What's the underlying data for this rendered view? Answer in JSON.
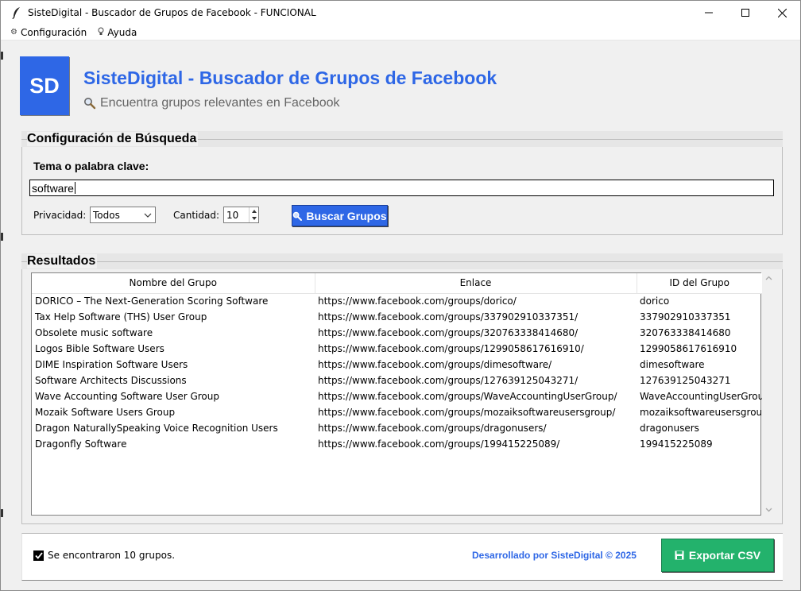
{
  "window": {
    "title": "SisteDigital - Buscador de Grupos de Facebook - FUNCIONAL",
    "icon": "feather-icon"
  },
  "menu": {
    "items": [
      {
        "label": "Configuración",
        "icon": "gear-icon"
      },
      {
        "label": "Ayuda",
        "icon": "lightbulb-icon"
      }
    ]
  },
  "header": {
    "logo_text": "SD",
    "title": "SisteDigital - Buscador de Grupos de Facebook",
    "subtitle": "Encuentra grupos relevantes en Facebook"
  },
  "search": {
    "section_title": "Configuración de Búsqueda",
    "keyword_label": "Tema o palabra clave:",
    "keyword_value": "software",
    "privacy_label": "Privacidad:",
    "privacy_value": "Todos",
    "quantity_label": "Cantidad:",
    "quantity_value": "10",
    "search_button": "Buscar Grupos"
  },
  "results": {
    "section_title": "Resultados",
    "columns": [
      "Nombre del Grupo",
      "Enlace",
      "ID del Grupo"
    ],
    "rows": [
      [
        "DORICO – The Next-Generation Scoring Software",
        "https://www.facebook.com/groups/dorico/",
        "dorico"
      ],
      [
        "Tax Help Software (THS) User Group",
        "https://www.facebook.com/groups/337902910337351/",
        "337902910337351"
      ],
      [
        "Obsolete music software",
        "https://www.facebook.com/groups/320763338414680/",
        "320763338414680"
      ],
      [
        "Logos Bible Software Users",
        "https://www.facebook.com/groups/1299058617616910/",
        "1299058617616910"
      ],
      [
        "DIME Inspiration Software Users",
        "https://www.facebook.com/groups/dimesoftware/",
        "dimesoftware"
      ],
      [
        "Software Architects Discussions",
        "https://www.facebook.com/groups/127639125043271/",
        "127639125043271"
      ],
      [
        "Wave Accounting Software User Group",
        "https://www.facebook.com/groups/WaveAccountingUserGroup/",
        "WaveAccountingUserGroup"
      ],
      [
        "Mozaik Software Users Group",
        "https://www.facebook.com/groups/mozaiksoftwareusersgroup/",
        "mozaiksoftwareusersgroup"
      ],
      [
        "Dragon NaturallySpeaking Voice Recognition Users",
        "https://www.facebook.com/groups/dragonusers/",
        "dragonusers"
      ],
      [
        "Dragonfly Software",
        "https://www.facebook.com/groups/199415225089/",
        "199415225089"
      ]
    ]
  },
  "footer": {
    "status_text": "Se encontraron 10 grupos.",
    "status_checked": true,
    "credit": "Desarrollado por SisteDigital © 2025",
    "export_button": "Exportar CSV"
  },
  "colors": {
    "brand_blue": "#2e67e6",
    "export_green": "#23b26c"
  }
}
